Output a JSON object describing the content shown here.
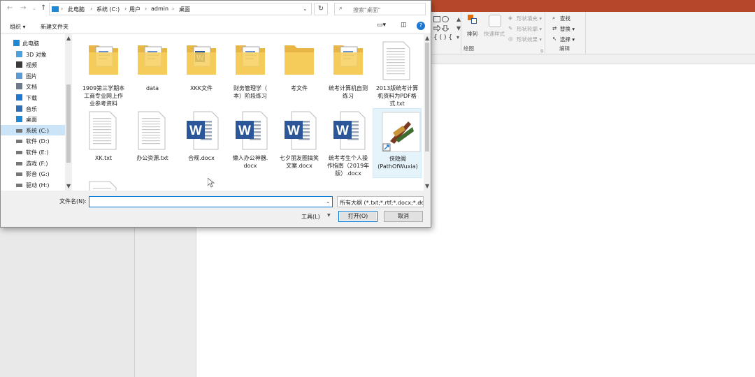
{
  "window": {
    "title_color": "#b7472a"
  },
  "address_bar": {
    "breadcrumb": [
      "此电脑",
      "系统 (C:)",
      "用户",
      "admin",
      "桌面"
    ],
    "search_placeholder": "搜索\"桌面\""
  },
  "toolbar": {
    "organize": "组织 ▾",
    "new_folder": "新建文件夹"
  },
  "nav_pane": {
    "items": [
      {
        "label": "此电脑",
        "icon": "computer-icon"
      },
      {
        "label": "3D 对象",
        "icon": "3d-objects-icon"
      },
      {
        "label": "视频",
        "icon": "video-icon"
      },
      {
        "label": "图片",
        "icon": "pictures-icon"
      },
      {
        "label": "文档",
        "icon": "documents-icon"
      },
      {
        "label": "下载",
        "icon": "download-icon"
      },
      {
        "label": "音乐",
        "icon": "music-icon"
      },
      {
        "label": "桌面",
        "icon": "desktop-icon"
      },
      {
        "label": "系统 (C:)",
        "icon": "drive-icon",
        "selected": true
      },
      {
        "label": "软件 (D:)",
        "icon": "drive-icon"
      },
      {
        "label": "软件 (E:)",
        "icon": "drive-icon"
      },
      {
        "label": "游戏 (F:)",
        "icon": "drive-icon"
      },
      {
        "label": "影音 (G:)",
        "icon": "drive-icon"
      },
      {
        "label": "驱动 (H:)",
        "icon": "drive-icon"
      }
    ]
  },
  "files": [
    {
      "name": "1909第三学期本\n工商专业网上作\n业参考资料",
      "icon": "folder-docs-icon"
    },
    {
      "name": "data",
      "icon": "folder-docs-icon"
    },
    {
      "name": "XKK文件",
      "icon": "folder-word-icon"
    },
    {
      "name": "财务管理学（\n本）阶段练习",
      "icon": "folder-docs-icon"
    },
    {
      "name": "考文件",
      "icon": "folder-icon"
    },
    {
      "name": "统考计算机自测\n练习",
      "icon": "folder-docs-icon"
    },
    {
      "name": "2013版统考计算\n机资料为PDF格\n式.txt",
      "icon": "text-file-icon"
    },
    {
      "name": "XK.txt",
      "icon": "text-file-icon"
    },
    {
      "name": "办公资源.txt",
      "icon": "text-file-icon"
    },
    {
      "name": "合规.docx",
      "icon": "word-doc-icon"
    },
    {
      "name": "懒人办公神器.\ndocx",
      "icon": "word-doc-icon"
    },
    {
      "name": "七夕朋友圈搞笑\n文案.docx",
      "icon": "word-doc-icon"
    },
    {
      "name": "统考考生个人操\n作指南（2019年\n版）.docx",
      "icon": "word-doc-icon"
    },
    {
      "name": "侠隐阁\n(PathOfWuxia)",
      "icon": "game-shortcut-icon",
      "selected": true
    },
    {
      "name": "",
      "icon": "text-file-icon"
    }
  ],
  "footer": {
    "filename_label": "文件名(N):",
    "filename_value": "",
    "filter": "所有大纲 (*.txt;*.rtf;*.docx;*.do",
    "tools": "工具(L)",
    "open": "打开(O)",
    "cancel": "取消"
  },
  "ribbon": {
    "arrange": "排列",
    "quick_styles": "快速样式",
    "shape_fill": "形状填充 ▾",
    "shape_outline": "形状轮廓 ▾",
    "shape_effects": "形状效果 ▾",
    "drawing_group": "绘图",
    "find": "查找",
    "replace": "替换 ▾",
    "select": "选择 ▾",
    "editing_group": "编辑"
  }
}
